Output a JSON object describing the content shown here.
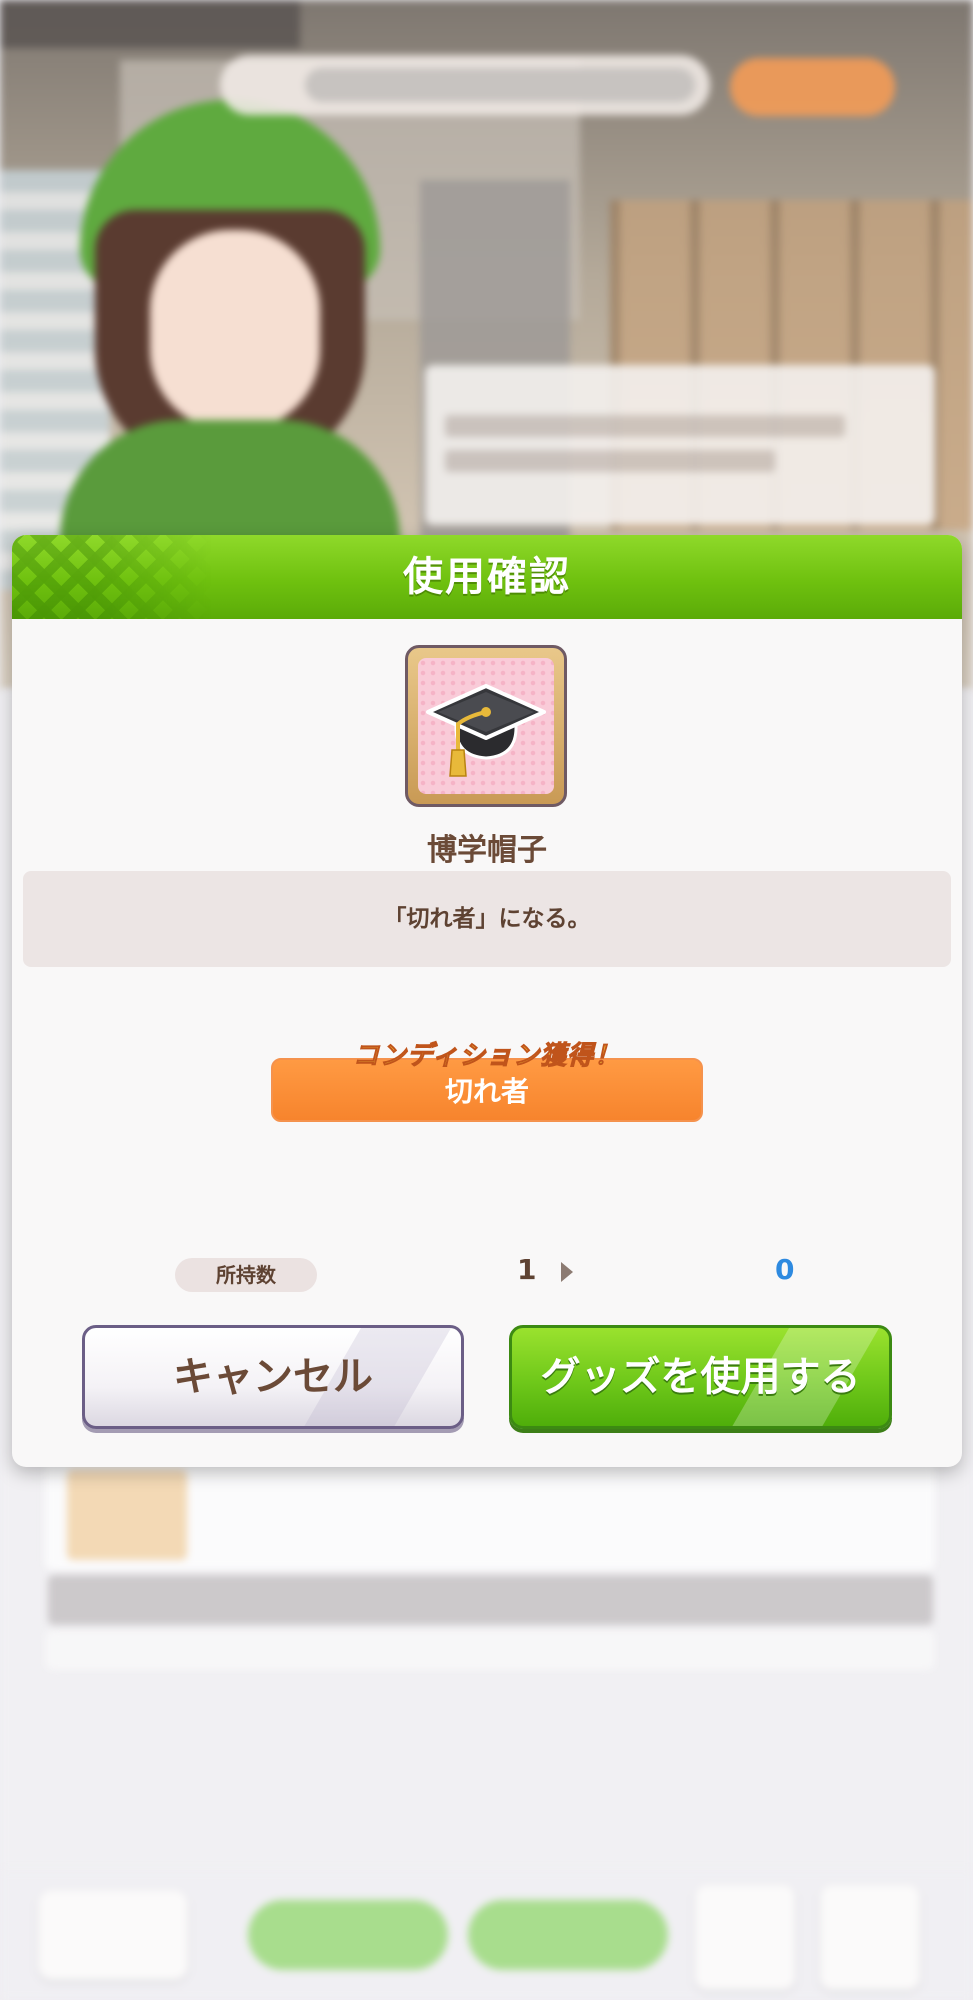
{
  "modal": {
    "title": "使用確認",
    "item": {
      "name": "博学帽子",
      "icon": "graduation-cap-icon",
      "description": "「切れ者」になる。"
    },
    "condition": {
      "label": "コンディション獲得！",
      "value": "切れ者"
    },
    "owned": {
      "label": "所持数",
      "before": "1",
      "after": "0"
    },
    "buttons": {
      "cancel": "キャンセル",
      "use": "グッズを使用する"
    }
  },
  "colors": {
    "header_green": "#6fc10f",
    "condition_orange": "#f7842d",
    "after_count_blue": "#2e8ae0",
    "text_brown": "#5e4232"
  }
}
